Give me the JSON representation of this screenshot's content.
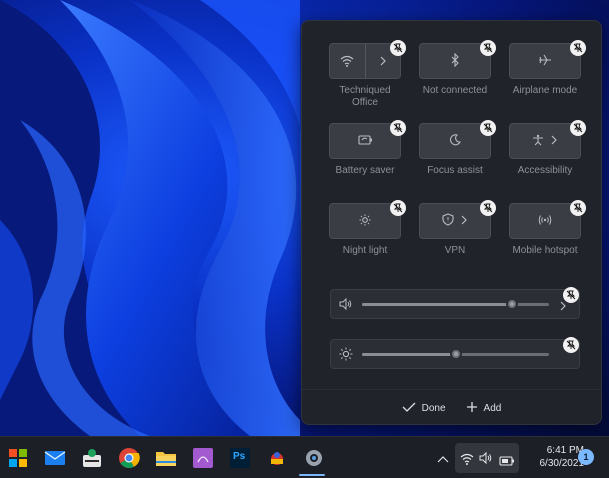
{
  "panel": {
    "tiles": [
      {
        "label": "Techniqued Office",
        "icon": "wifi-icon"
      },
      {
        "label": "Not connected",
        "icon": "bluetooth-icon"
      },
      {
        "label": "Airplane mode",
        "icon": "airplane-icon"
      },
      {
        "label": "Battery saver",
        "icon": "battery-saver-icon"
      },
      {
        "label": "Focus assist",
        "icon": "moon-icon"
      },
      {
        "label": "Accessibility",
        "icon": "accessibility-icon"
      },
      {
        "label": "Night light",
        "icon": "sun-icon"
      },
      {
        "label": "VPN",
        "icon": "shield-icon"
      },
      {
        "label": "Mobile hotspot",
        "icon": "hotspot-icon"
      }
    ],
    "volume": {
      "icon": "speaker-icon",
      "level": 0.8
    },
    "brightness": {
      "icon": "brightness-icon",
      "level": 0.5
    },
    "footer": {
      "done_label": "Done",
      "add_label": "Add"
    }
  },
  "taskbar": {
    "apps": [
      "start-icon",
      "mail-icon",
      "snip-icon",
      "chrome-icon",
      "file-explorer-icon",
      "app-icon",
      "photoshop-icon",
      "misc-app-icon",
      "settings-icon"
    ],
    "photoshop_text": "Ps",
    "time": "6:41 PM",
    "date": "6/30/2021",
    "notification_count": "1"
  }
}
